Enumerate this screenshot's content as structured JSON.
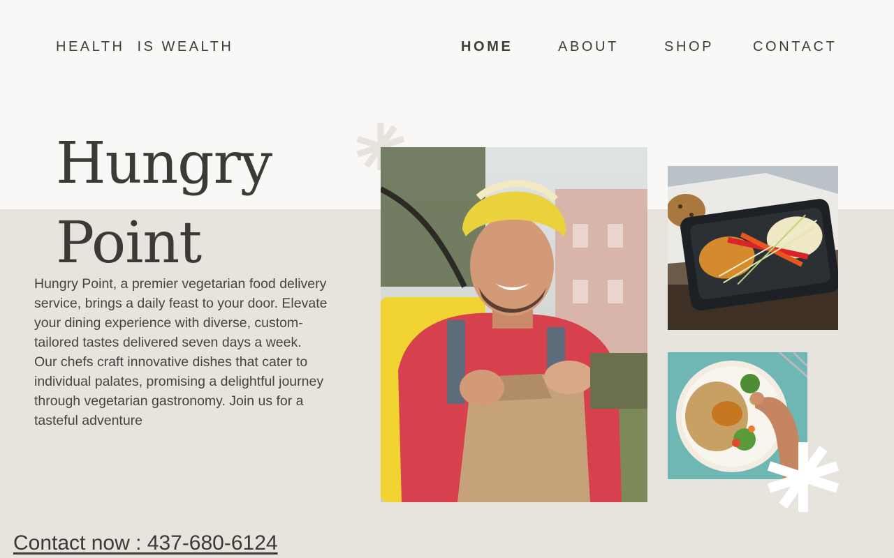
{
  "header": {
    "brand": "HEALTH  IS WEALTH",
    "nav": [
      {
        "label": "HOME",
        "active": true
      },
      {
        "label": "ABOUT",
        "active": false
      },
      {
        "label": "SHOP",
        "active": false
      },
      {
        "label": "CONTACT",
        "active": false
      }
    ]
  },
  "hero": {
    "title_line1": "Hungry",
    "title_line2": "Point",
    "description": "Hungry Point, a premier vegetarian food delivery service, brings a daily feast to your door. Elevate your dining experience with diverse, custom-tailored tastes delivered seven days a week. Our chefs craft innovative dishes that cater to individual palates, promising a delightful journey through vegetarian gastronomy. Join us for a tasteful adventure",
    "contact": "Contact now : 437-680-6124"
  },
  "images": {
    "main": "delivery-courier-photo",
    "top": "takeout-meal-container-photo",
    "bottom": "plated-meal-photo"
  },
  "colors": {
    "background": "#f9f8f6",
    "band": "#e7e4de",
    "text": "#3c3a36",
    "accent_star": "#e8e2dc"
  }
}
